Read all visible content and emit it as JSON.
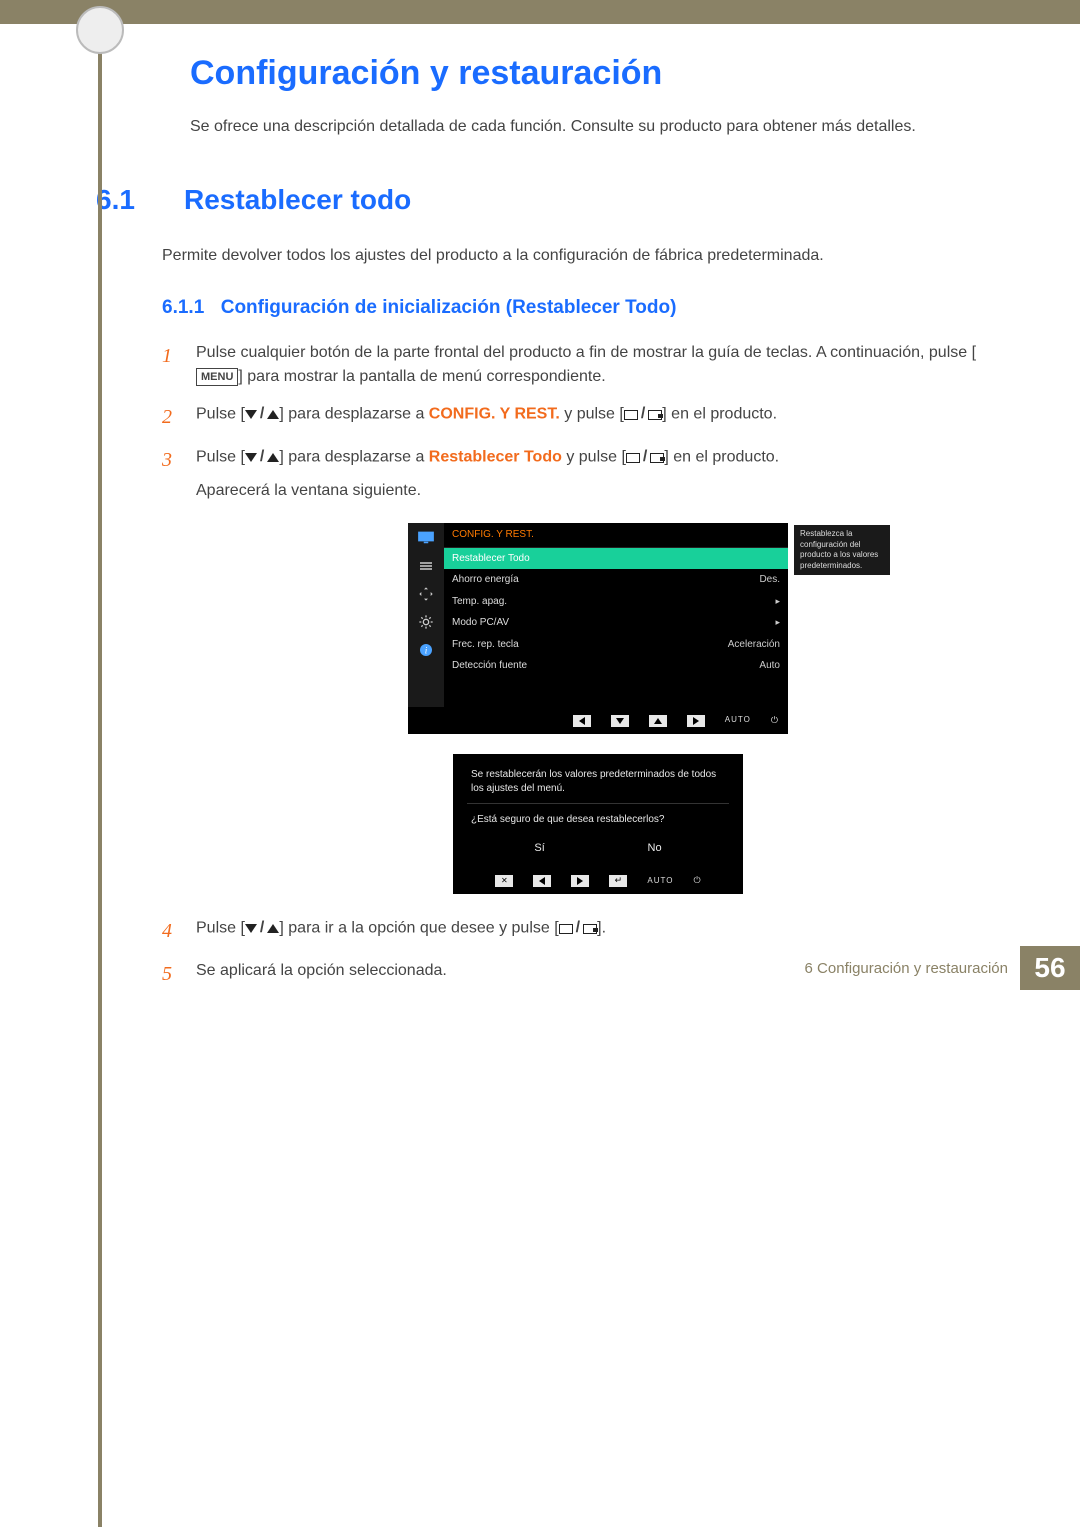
{
  "chapter_number": "6",
  "title": "Configuración y restauración",
  "intro": "Se ofrece una descripción detallada de cada función. Consulte su producto para obtener más detalles.",
  "section": {
    "num": "6.1",
    "title": "Restablecer todo",
    "desc": "Permite devolver todos los ajustes del producto a la configuración de fábrica predeterminada."
  },
  "subsection": {
    "num": "6.1.1",
    "title": "Configuración de inicialización (Restablecer Todo)"
  },
  "menu_label": "MENU",
  "steps": {
    "s1": {
      "num": "1",
      "a": "Pulse cualquier botón de la parte frontal del producto a fin de mostrar la guía de teclas. A continuación, pulse [",
      "b": "] para mostrar la pantalla de menú correspondiente."
    },
    "s2": {
      "num": "2",
      "a": "Pulse [",
      "b": "] para desplazarse a ",
      "hi": "CONFIG. Y REST.",
      "c": " y pulse [",
      "d": "] en el producto."
    },
    "s3": {
      "num": "3",
      "a": "Pulse [",
      "b": "] para desplazarse a ",
      "hi": "Restablecer Todo",
      "c": " y pulse [",
      "d": "] en el producto.",
      "e": "Aparecerá la ventana siguiente."
    },
    "s4": {
      "num": "4",
      "a": "Pulse [",
      "b": "] para ir a la opción que desee y pulse [",
      "c": "]."
    },
    "s5": {
      "num": "5",
      "a": "Se aplicará la opción seleccionada."
    }
  },
  "osd": {
    "head": "CONFIG. Y REST.",
    "tooltip": "Restablezca la configuración del producto a los valores predeterminados.",
    "items": [
      {
        "label": "Restablecer Todo",
        "value": "",
        "selected": true
      },
      {
        "label": "Ahorro energía",
        "value": "Des."
      },
      {
        "label": "Temp. apag.",
        "value": "▸"
      },
      {
        "label": "Modo PC/AV",
        "value": "▸"
      },
      {
        "label": "Frec. rep. tecla",
        "value": "Aceleración"
      },
      {
        "label": "Detección fuente",
        "value": "Auto"
      }
    ],
    "auto": "AUTO"
  },
  "confirm": {
    "msg": "Se restablecerán los valores predeterminados de todos los ajustes del menú.",
    "q": "¿Está seguro de que desea restablecerlos?",
    "yes": "Sí",
    "no": "No",
    "auto": "AUTO"
  },
  "footer": {
    "text": "6 Configuración y restauración",
    "page": "56"
  }
}
